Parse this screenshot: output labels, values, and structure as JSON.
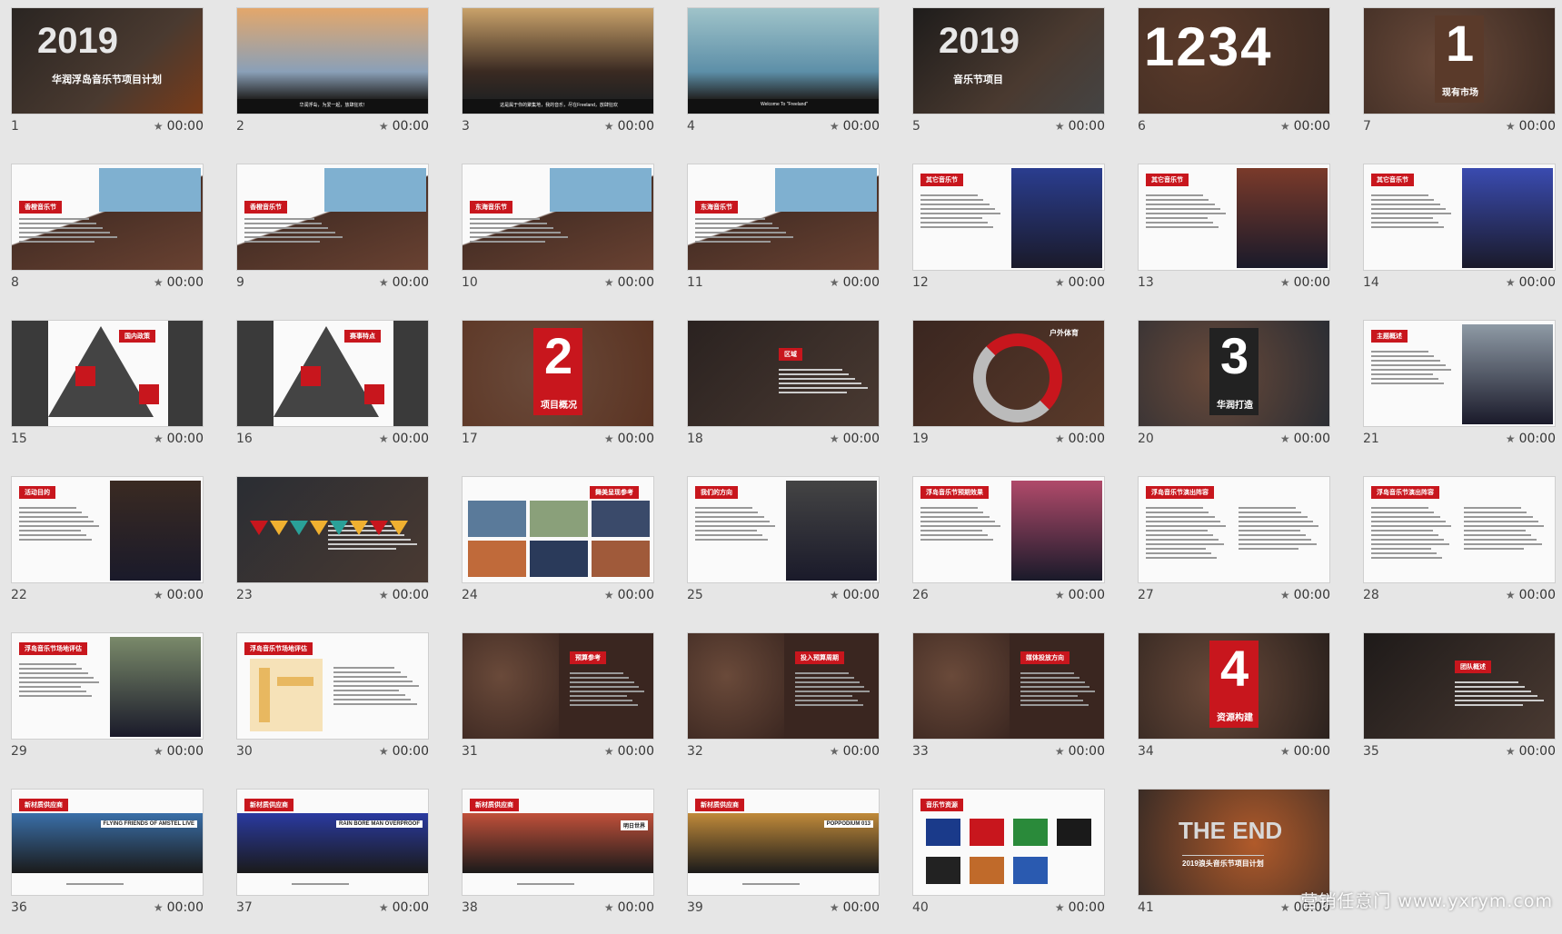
{
  "slides": [
    {
      "num": "1",
      "time": "00:00",
      "kind": "title-2019",
      "title": "2019",
      "sub": "华润浮岛音乐节项目计划",
      "bg": "#2a2522",
      "accent": "#7a3b18"
    },
    {
      "num": "2",
      "time": "00:00",
      "kind": "photo",
      "caption": "华润浮岛，为爱一起，放肆狂欢！",
      "bg": "#8aa0b8",
      "accent": "#e3a76b"
    },
    {
      "num": "3",
      "time": "00:00",
      "kind": "photo",
      "caption": "这是属于你的聚集地，我的音乐，尽在Freeland，放肆狂欢",
      "bg": "#3a2a22",
      "accent": "#c9a26a"
    },
    {
      "num": "4",
      "time": "00:00",
      "kind": "photo",
      "caption": "Welcome To \"Freeland\"",
      "bg": "#5d8fa8",
      "accent": "#9fc3c9"
    },
    {
      "num": "5",
      "time": "00:00",
      "kind": "title-2019",
      "title": "2019",
      "sub": "音乐节项目",
      "bg": "#1e1c1b",
      "accent": "#444"
    },
    {
      "num": "6",
      "time": "00:00",
      "kind": "numbers",
      "title": "1234",
      "bg": "#3b2a22",
      "accent": "#5a3a2a"
    },
    {
      "num": "7",
      "time": "00:00",
      "kind": "big-num",
      "title": "1",
      "sub": "现有市场",
      "bg": "#3b2a22",
      "accent": "#5a3a2a"
    },
    {
      "num": "8",
      "time": "00:00",
      "kind": "diag",
      "tag": "香橙音乐节",
      "bg": "#fafafa",
      "accent": "#c8161d"
    },
    {
      "num": "9",
      "time": "00:00",
      "kind": "diag",
      "tag": "香橙音乐节",
      "bg": "#fafafa",
      "accent": "#c8161d"
    },
    {
      "num": "10",
      "time": "00:00",
      "kind": "diag",
      "tag": "东海音乐节",
      "bg": "#fafafa",
      "accent": "#c8161d"
    },
    {
      "num": "11",
      "time": "00:00",
      "kind": "diag",
      "tag": "东海音乐节",
      "bg": "#fafafa",
      "accent": "#c8161d"
    },
    {
      "num": "12",
      "time": "00:00",
      "kind": "text-photo",
      "tag": "其它音乐节",
      "bg": "#fafafa",
      "accent": "#2a3d8f"
    },
    {
      "num": "13",
      "time": "00:00",
      "kind": "text-photo",
      "tag": "其它音乐节",
      "bg": "#fafafa",
      "accent": "#7a3a2a"
    },
    {
      "num": "14",
      "time": "00:00",
      "kind": "text-photo",
      "tag": "其它音乐节",
      "bg": "#fafafa",
      "accent": "#3a4bb0"
    },
    {
      "num": "15",
      "time": "00:00",
      "kind": "triangle",
      "tag": "国内政策",
      "bg": "#fafafa",
      "accent": "#c8161d"
    },
    {
      "num": "16",
      "time": "00:00",
      "kind": "triangle",
      "tag": "赛事特点",
      "bg": "#fafafa",
      "accent": "#c8161d"
    },
    {
      "num": "17",
      "time": "00:00",
      "kind": "big-num",
      "title": "2",
      "sub": "项目概况",
      "bg": "#5a3322",
      "accent": "#c8161d"
    },
    {
      "num": "18",
      "time": "00:00",
      "kind": "dark-text",
      "tag": "区域",
      "bg": "#2a2220",
      "accent": "#c8161d"
    },
    {
      "num": "19",
      "time": "00:00",
      "kind": "donut",
      "tag": "户外体育",
      "bg": "#3a2620",
      "accent": "#c8161d"
    },
    {
      "num": "20",
      "time": "00:00",
      "kind": "big-num",
      "title": "3",
      "sub": "华润打造",
      "bg": "#2a2d33",
      "accent": "#222"
    },
    {
      "num": "21",
      "time": "00:00",
      "kind": "text-photo",
      "tag": "主题概述",
      "bg": "#fafafa",
      "accent": "#8e9aa5"
    },
    {
      "num": "22",
      "time": "00:00",
      "kind": "text-photo",
      "tag": "活动目的",
      "bg": "#fafafa",
      "accent": "#3a2a22"
    },
    {
      "num": "23",
      "time": "00:00",
      "kind": "dark-text",
      "tag": "",
      "bg": "#2a2d33",
      "accent": "#2aa198"
    },
    {
      "num": "24",
      "time": "00:00",
      "kind": "collage",
      "tag": "舞美呈现参考",
      "bg": "#fafafa",
      "accent": "#3a7ab0"
    },
    {
      "num": "25",
      "time": "00:00",
      "kind": "text-photo",
      "tag": "我们的方向",
      "bg": "#fafafa",
      "accent": "#444"
    },
    {
      "num": "26",
      "time": "00:00",
      "kind": "text-photo",
      "tag": "浮岛音乐节预期效果",
      "bg": "#fafafa",
      "accent": "#b04a6a"
    },
    {
      "num": "27",
      "time": "00:00",
      "kind": "text",
      "tag": "浮岛音乐节演出阵容",
      "bg": "#fafafa",
      "accent": "#c8161d"
    },
    {
      "num": "28",
      "time": "00:00",
      "kind": "text",
      "tag": "浮岛音乐节演出阵容",
      "bg": "#fafafa",
      "accent": "#c8161d"
    },
    {
      "num": "29",
      "time": "00:00",
      "kind": "text-photo",
      "tag": "浮岛音乐节场地评估",
      "bg": "#fafafa",
      "accent": "#7a8a6a"
    },
    {
      "num": "30",
      "time": "00:00",
      "kind": "map",
      "tag": "浮岛音乐节场地评估",
      "bg": "#fafafa",
      "accent": "#e8b860"
    },
    {
      "num": "31",
      "time": "00:00",
      "kind": "photo-text",
      "tag": "预算参考",
      "bg": "#3a2620",
      "accent": "#c8161d"
    },
    {
      "num": "32",
      "time": "00:00",
      "kind": "photo-text",
      "tag": "投入预算周期",
      "bg": "#3a2620",
      "accent": "#c8161d"
    },
    {
      "num": "33",
      "time": "00:00",
      "kind": "photo-text",
      "tag": "媒体投放方向",
      "bg": "#3a2620",
      "accent": "#c8161d"
    },
    {
      "num": "34",
      "time": "00:00",
      "kind": "big-num",
      "title": "4",
      "sub": "资源构建",
      "bg": "#2a211d",
      "accent": "#c8161d"
    },
    {
      "num": "35",
      "time": "00:00",
      "kind": "dark-text",
      "tag": "团队概述",
      "bg": "#1e1a19",
      "accent": "#c8161d"
    },
    {
      "num": "36",
      "time": "00:00",
      "kind": "band",
      "tag": "新材质供应商",
      "caption": "FLYING FRIENDS OF AMSTEL LIVE",
      "bg": "#fafafa",
      "accent": "#3a6fa8"
    },
    {
      "num": "37",
      "time": "00:00",
      "kind": "band",
      "tag": "新材质供应商",
      "caption": "RAIN BORE MAN OVERPROOF",
      "bg": "#fafafa",
      "accent": "#2a3aa0"
    },
    {
      "num": "38",
      "time": "00:00",
      "kind": "band",
      "tag": "新材质供应商",
      "caption": "明日世界",
      "bg": "#fafafa",
      "accent": "#c0503a"
    },
    {
      "num": "39",
      "time": "00:00",
      "kind": "band",
      "tag": "新材质供应商",
      "caption": "POPPODIUM 013",
      "bg": "#fafafa",
      "accent": "#c08a3a"
    },
    {
      "num": "40",
      "time": "00:00",
      "kind": "logos",
      "tag": "音乐节资源",
      "bg": "#fafafa",
      "accent": "#1a3a8a"
    },
    {
      "num": "41",
      "time": "00:00",
      "kind": "end",
      "title": "THE END",
      "sub": "2019浪头音乐节项目计划",
      "bg": "#3a2c26",
      "accent": "#b05a2a"
    }
  ],
  "watermark": "营销任意门 www.yxrym.com"
}
